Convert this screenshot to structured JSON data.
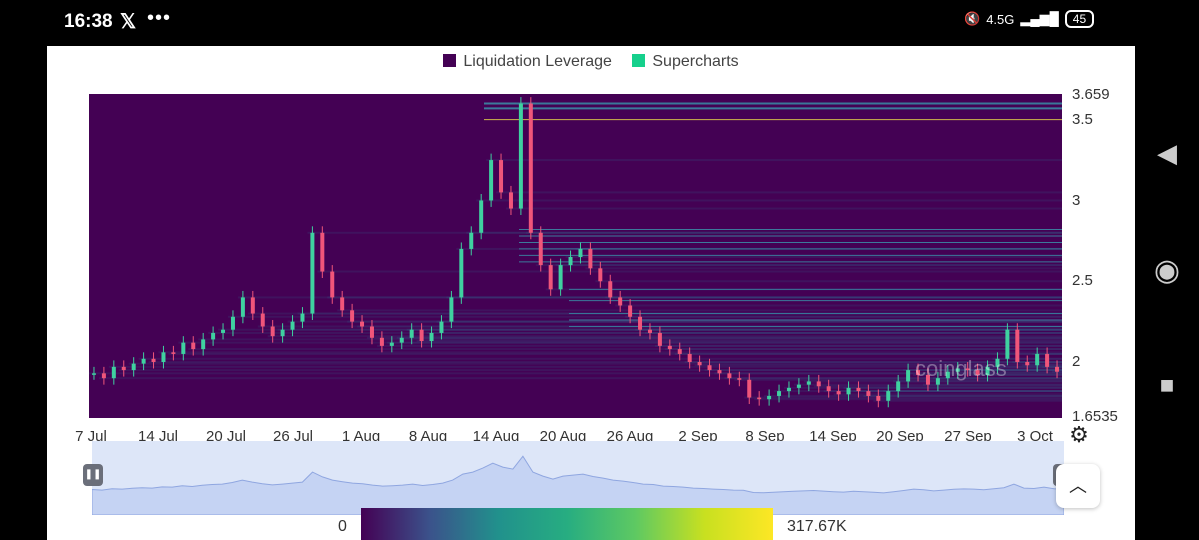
{
  "status_bar": {
    "time": "16:38",
    "app_icon": "x-logo-icon",
    "more": "•••",
    "network": "4.5G",
    "battery": "45"
  },
  "legend": {
    "items": [
      {
        "label": "Liquidation Leverage",
        "color": "#440154"
      },
      {
        "label": "Supercharts",
        "color": "#16d08c"
      }
    ]
  },
  "chart_data": {
    "type": "heatmap",
    "title": "",
    "x_ticks": [
      "7 Jul",
      "14 Jul",
      "20 Jul",
      "26 Jul",
      "1 Aug",
      "8 Aug",
      "14 Aug",
      "20 Aug",
      "26 Aug",
      "2 Sep",
      "8 Sep",
      "14 Sep",
      "20 Sep",
      "27 Sep",
      "3 Oct"
    ],
    "y_ticks": [
      "3.659",
      "3.5",
      "3",
      "2.5",
      "2",
      "1.6535"
    ],
    "ylim": [
      1.6535,
      3.659
    ],
    "price_series": [
      1.93,
      1.9,
      1.97,
      1.95,
      1.99,
      2.02,
      2.0,
      2.06,
      2.05,
      2.12,
      2.08,
      2.14,
      2.18,
      2.2,
      2.28,
      2.4,
      2.3,
      2.22,
      2.16,
      2.2,
      2.25,
      2.3,
      2.8,
      2.56,
      2.4,
      2.32,
      2.25,
      2.22,
      2.15,
      2.1,
      2.12,
      2.15,
      2.2,
      2.13,
      2.18,
      2.25,
      2.4,
      2.7,
      2.8,
      3.0,
      3.25,
      3.05,
      2.95,
      3.6,
      2.8,
      2.6,
      2.45,
      2.6,
      2.65,
      2.7,
      2.58,
      2.5,
      2.4,
      2.35,
      2.28,
      2.2,
      2.18,
      2.1,
      2.08,
      2.05,
      2.0,
      1.98,
      1.95,
      1.93,
      1.9,
      1.89,
      1.78,
      1.77,
      1.79,
      1.82,
      1.84,
      1.86,
      1.88,
      1.85,
      1.82,
      1.8,
      1.84,
      1.82,
      1.79,
      1.76,
      1.82,
      1.88,
      1.95,
      1.92,
      1.86,
      1.9,
      1.94,
      1.96,
      1.95,
      1.92,
      1.97,
      2.02,
      2.2,
      2.0,
      1.98,
      2.05,
      1.97,
      1.94
    ],
    "levels": [
      3.6,
      3.57,
      3.5,
      2.82,
      2.78,
      2.74,
      2.7,
      2.66,
      2.62,
      2.45,
      2.38,
      2.3,
      2.26,
      2.22
    ],
    "colorscale": {
      "min": "0",
      "max": "317.67K"
    }
  },
  "controls": {
    "gear": "gear-icon",
    "collapse": "chevron-up-icon",
    "pause": "pause-icon"
  },
  "watermark": "coinglass"
}
